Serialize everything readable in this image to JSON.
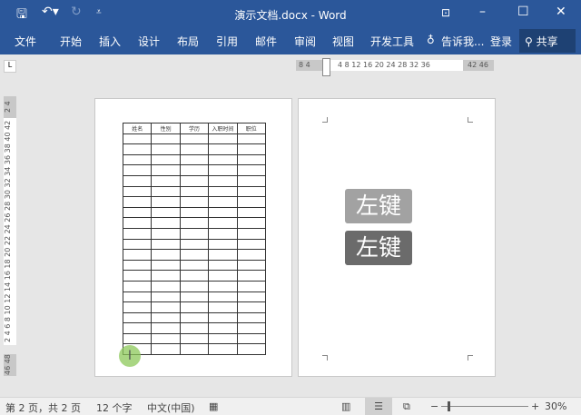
{
  "window": {
    "title": "演示文档.docx - Word"
  },
  "ribbon": {
    "tabs": [
      "文件",
      "开始",
      "插入",
      "设计",
      "布局",
      "引用",
      "邮件",
      "审阅",
      "视图",
      "开发工具"
    ],
    "tell_me": "告诉我...",
    "login": "登录",
    "share": "共享"
  },
  "ruler": {
    "left": "8  4",
    "main": "4  8  12  16  20  24  28  32  36",
    "right": "42  46"
  },
  "vruler": {
    "top": "2 4",
    "main": "2 4 6 8 10 12 14 16 18 20 22 24 26 28 30 32 34 36 38 40 42",
    "bottom": "46 48"
  },
  "table": {
    "headers": [
      "姓名",
      "性别",
      "学历",
      "入职时间",
      "职位"
    ],
    "empty_rows": 21
  },
  "overlay": {
    "button_light": "左键",
    "button_dark": "左键"
  },
  "status": {
    "page": "第 2 页，共 2 页",
    "words": "12 个字",
    "language": "中文(中国)",
    "zoom": "30%"
  }
}
